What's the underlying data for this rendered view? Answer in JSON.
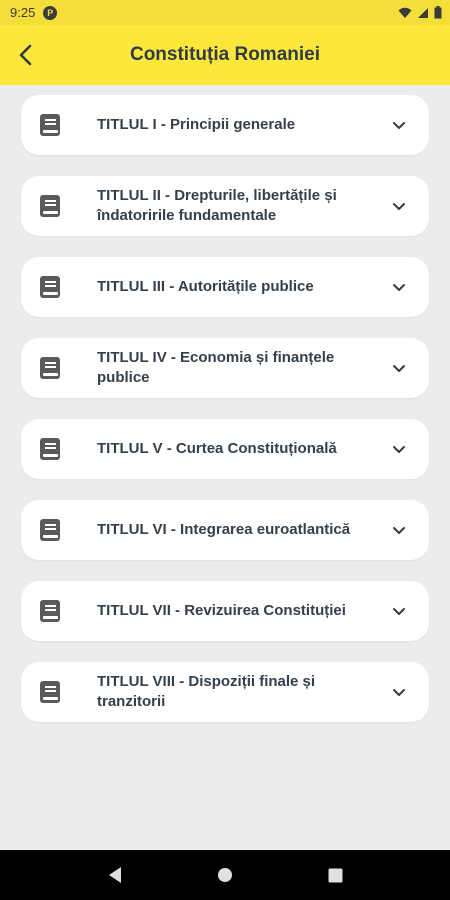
{
  "status_bar": {
    "time": "9:25",
    "app_badge": "P"
  },
  "header": {
    "title": "Constituția Romaniei"
  },
  "titles": [
    {
      "label": "TITLUL I - Principii generale"
    },
    {
      "label": "TITLUL II - Drepturile, libertățile și îndatoririle fundamentale"
    },
    {
      "label": "TITLUL III - Autoritățile publice"
    },
    {
      "label": "TITLUL IV - Economia și finanțele publice"
    },
    {
      "label": "TITLUL V - Curtea Constituțională"
    },
    {
      "label": "TITLUL VI - Integrarea euroatlantică"
    },
    {
      "label": "TITLUL VII - Revizuirea Constituției"
    },
    {
      "label": "TITLUL VIII - Dispoziții finale și tranzitorii"
    }
  ],
  "colors": {
    "accent": "#fde73a",
    "text": "#34404c",
    "icon": "#5a5a5a"
  },
  "icons": {
    "back": "arrow-left-icon",
    "item": "book-icon",
    "expand": "chevron-down-icon"
  }
}
